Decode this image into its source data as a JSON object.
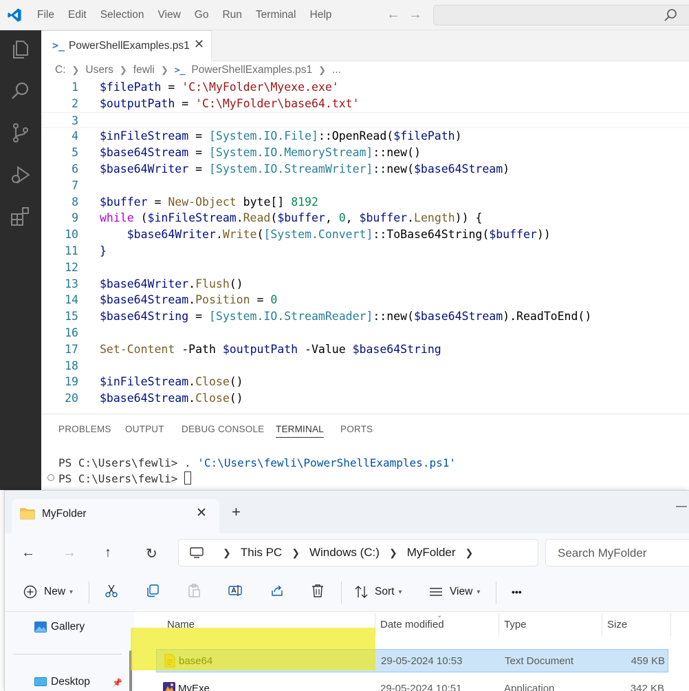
{
  "vscode": {
    "menu": [
      "File",
      "Edit",
      "Selection",
      "View",
      "Go",
      "Run",
      "Terminal",
      "Help"
    ],
    "tab": {
      "icon_text": ">_",
      "label": "PowerShellExamples.ps1"
    },
    "breadcrumb": [
      "C:",
      "Users",
      "fewli",
      "PowerShellExamples.ps1",
      "..."
    ],
    "code_lines": [
      {
        "n": "1"
      },
      {
        "n": "2"
      },
      {
        "n": "3"
      },
      {
        "n": "4"
      },
      {
        "n": "5"
      },
      {
        "n": "6"
      },
      {
        "n": "7"
      },
      {
        "n": "8"
      },
      {
        "n": "9"
      },
      {
        "n": "10"
      },
      {
        "n": "11"
      },
      {
        "n": "12"
      },
      {
        "n": "13"
      },
      {
        "n": "14"
      },
      {
        "n": "15"
      },
      {
        "n": "16"
      },
      {
        "n": "17"
      },
      {
        "n": "18"
      },
      {
        "n": "19"
      },
      {
        "n": "20"
      }
    ],
    "code_tokens": {
      "l1": [
        "$filePath",
        " = ",
        "'C:\\MyFolder\\Myexe.exe'"
      ],
      "l2": [
        "$outputPath",
        " = ",
        "'C:\\MyFolder\\base64.txt'"
      ],
      "l4": [
        "$inFileStream",
        " = ",
        "[System.IO.File]",
        "::",
        "OpenRead",
        "(",
        "$filePath",
        ")"
      ],
      "l5": [
        "$base64Stream",
        " = ",
        "[System.IO.MemoryStream]",
        "::",
        "new",
        "()"
      ],
      "l6": [
        "$base64Writer",
        " = ",
        "[System.IO.StreamWriter]",
        "::",
        "new",
        "(",
        "$base64Stream",
        ")"
      ],
      "l8": [
        "$buffer",
        " = ",
        "New-Object",
        " byte",
        "[]",
        " ",
        "8192"
      ],
      "l9": [
        "while",
        " (",
        "$inFileStream",
        ".",
        "Read",
        "(",
        "$buffer",
        ", ",
        "0",
        ", ",
        "$buffer",
        ".",
        "Length",
        ")) {"
      ],
      "l10": [
        "    ",
        "$base64Writer",
        ".",
        "Write",
        "(",
        "[System.Convert]",
        "::",
        "ToBase64String",
        "(",
        "$buffer",
        "))"
      ],
      "l11": [
        "}"
      ],
      "l13": [
        "$base64Writer",
        ".",
        "Flush",
        "()"
      ],
      "l14": [
        "$base64Stream",
        ".",
        "Position",
        " = ",
        "0"
      ],
      "l15": [
        "$base64String",
        " = ",
        "[System.IO.StreamReader]",
        "::",
        "new",
        "(",
        "$base64Stream",
        ").",
        "ReadToEnd",
        "()"
      ],
      "l17": [
        "Set-Content",
        " -Path ",
        "$outputPath",
        " -Value ",
        "$base64String"
      ],
      "l19": [
        "$inFileStream",
        ".",
        "Close",
        "()"
      ],
      "l20": [
        "$base64Stream",
        ".",
        "Close",
        "()"
      ]
    },
    "panel_tabs": [
      "PROBLEMS",
      "OUTPUT",
      "DEBUG CONSOLE",
      "TERMINAL",
      "PORTS"
    ],
    "terminal": {
      "prompt": "PS C:\\Users\\fewli> ",
      "command_prefix": ". ",
      "command_arg": "'C:\\Users\\fewli\\PowerShellExamples.ps1'"
    }
  },
  "explorer": {
    "tab_label": "MyFolder",
    "path": [
      "This PC",
      "Windows (C:)",
      "MyFolder"
    ],
    "search_placeholder": "Search MyFolder",
    "toolbar": {
      "new_label": "New",
      "sort_label": "Sort",
      "view_label": "View",
      "more_label": "•••"
    },
    "nav": [
      "Gallery",
      "Desktop"
    ],
    "columns": [
      "Name",
      "Date modified",
      "Type",
      "Size"
    ],
    "files": [
      {
        "name": "base64",
        "date": "29-05-2024 10:53",
        "type": "Text Document",
        "size": "459 KB",
        "icon": "text-file-icon",
        "selected": true
      },
      {
        "name": "MyExe",
        "date": "29-05-2024 10:51",
        "type": "Application",
        "size": "342 KB",
        "icon": "application-icon",
        "selected": false
      }
    ],
    "highlight_color": "#eee800"
  }
}
